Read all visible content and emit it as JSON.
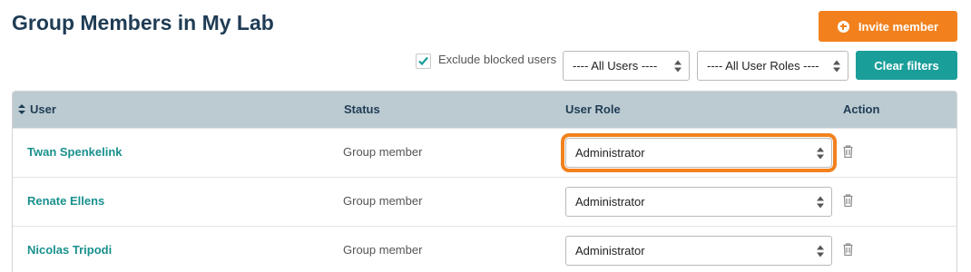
{
  "page": {
    "title": "Group Members in My Lab"
  },
  "actions": {
    "invite_label": "Invite member",
    "clear_filters_label": "Clear filters"
  },
  "filters": {
    "exclude_blocked_label": "Exclude blocked users",
    "exclude_blocked_checked": true,
    "users_select": "---- All Users ----",
    "roles_select": "---- All User Roles ----"
  },
  "table": {
    "headers": {
      "user": "User",
      "status": "Status",
      "role": "User Role",
      "action": "Action"
    },
    "rows": [
      {
        "user": "Twan Spenkelink",
        "status": "Group member",
        "role": "Administrator",
        "highlighted": true
      },
      {
        "user": "Renate Ellens",
        "status": "Group member",
        "role": "Administrator",
        "highlighted": false
      },
      {
        "user": "Nicolas Tripodi",
        "status": "Group member",
        "role": "Administrator",
        "highlighted": false
      }
    ]
  },
  "colors": {
    "accent_orange": "#f2811d",
    "teal": "#1a9e9a",
    "header_bg": "#bccbd2",
    "title": "#1f3c55"
  },
  "icons": {
    "invite": "plus-circle-icon",
    "sort": "sort-icon",
    "delete": "trash-icon",
    "checkbox": "check-icon"
  }
}
